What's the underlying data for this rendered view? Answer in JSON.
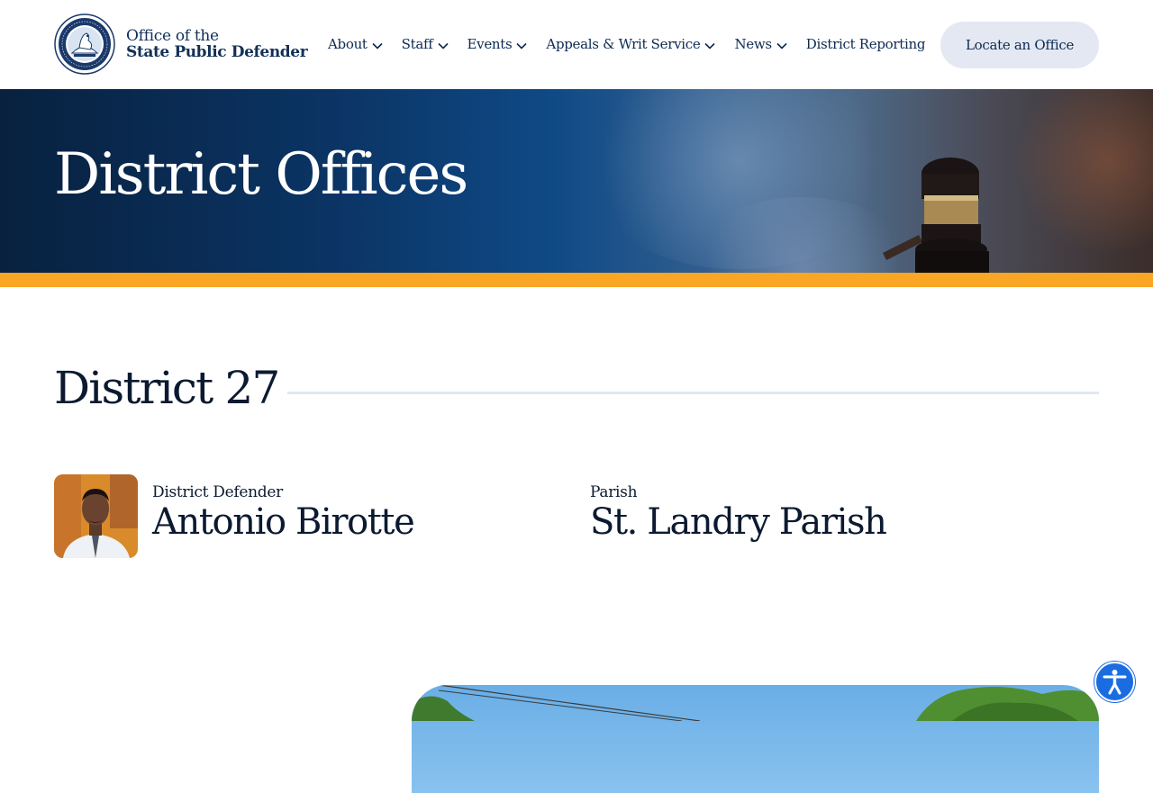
{
  "header": {
    "logo_line1": "Office of the",
    "logo_line2": "State Public Defender",
    "nav": [
      {
        "label": "About",
        "has_dropdown": true
      },
      {
        "label": "Staff",
        "has_dropdown": true
      },
      {
        "label": "Events",
        "has_dropdown": true
      },
      {
        "label": "Appeals & Writ Service",
        "has_dropdown": true
      },
      {
        "label": "News",
        "has_dropdown": true
      },
      {
        "label": "District Reporting",
        "has_dropdown": false
      }
    ],
    "cta_label": "Locate an Office"
  },
  "hero": {
    "title": "District Offices"
  },
  "district": {
    "heading": "District 27",
    "defender_label": "District Defender",
    "defender_name": "Antonio Birotte",
    "parish_label": "Parish",
    "parish_name": "St. Landry Parish"
  },
  "colors": {
    "accent_bar": "#f8a623",
    "navy": "#0d2a52",
    "cta_background": "#e3e8f3",
    "accessibility_button": "#1a6de0"
  },
  "icons": {
    "logo": "state-seal-icon",
    "nav_dropdown": "chevron-down-icon",
    "accessibility": "accessibility-icon"
  }
}
